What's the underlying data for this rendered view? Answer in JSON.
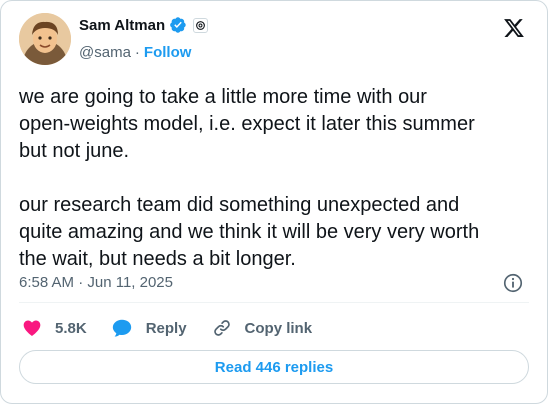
{
  "author": {
    "display_name": "Sam Altman",
    "handle": "@sama",
    "separator": "·",
    "follow_label": "Follow"
  },
  "icons": {
    "verified": "verified-badge-icon",
    "affiliation": "openai-logo-icon",
    "platform": "x-logo-icon",
    "info": "info-icon",
    "like": "heart-icon",
    "reply": "speech-bubble-icon",
    "copy_link": "link-icon"
  },
  "tweet": {
    "text": "we are going to take a little more time with our\nopen-weights model, i.e. expect it later this summer\nbut not june.\n\nour research team did something unexpected and\nquite amazing and we think it will be very very worth\nthe wait, but needs a bit longer.",
    "timestamp": "6:58 AM · Jun 11, 2025"
  },
  "actions": {
    "like_count": "5.8K",
    "reply_label": "Reply",
    "copy_link_label": "Copy link"
  },
  "read_replies_label": "Read 446 replies",
  "colors": {
    "accent": "#1d9bf0",
    "like": "#f91880",
    "text": "#0f1419",
    "secondary": "#536471",
    "border": "#cfd9de"
  }
}
